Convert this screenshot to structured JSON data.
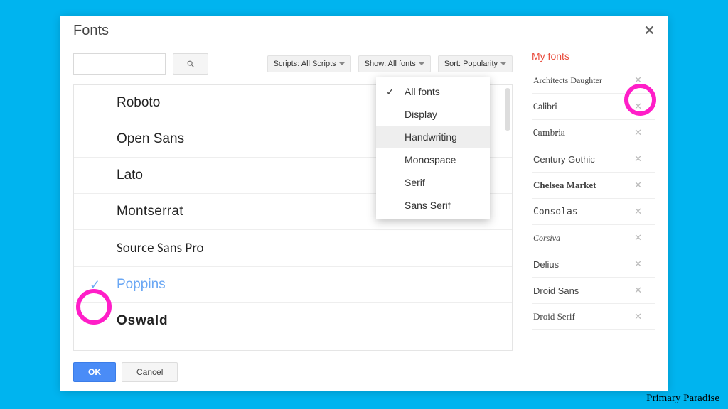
{
  "dialog": {
    "title": "Fonts",
    "search_placeholder": "",
    "filters": {
      "scripts": "Scripts: All Scripts",
      "show": "Show: All fonts",
      "sort": "Sort: Popularity"
    },
    "show_dropdown": {
      "options": [
        "All fonts",
        "Display",
        "Handwriting",
        "Monospace",
        "Serif",
        "Sans Serif"
      ],
      "selected": "All fonts",
      "hovered": "Handwriting"
    },
    "fonts": [
      {
        "name": "Roboto",
        "cls": "f-roboto",
        "selected": false
      },
      {
        "name": "Open Sans",
        "cls": "f-opensans",
        "selected": false
      },
      {
        "name": "Lato",
        "cls": "f-lato",
        "selected": false
      },
      {
        "name": "Montserrat",
        "cls": "f-mont",
        "selected": false
      },
      {
        "name": "Source Sans Pro",
        "cls": "f-source",
        "selected": false
      },
      {
        "name": "Poppins",
        "cls": "f-poppins",
        "selected": true
      },
      {
        "name": "Oswald",
        "cls": "f-oswald",
        "selected": false
      }
    ],
    "my_fonts_title": "My fonts",
    "my_fonts": [
      {
        "name": "Architects Daughter",
        "cls": "mf-arch"
      },
      {
        "name": "Calibri",
        "cls": "mf-cal"
      },
      {
        "name": "Cambria",
        "cls": "mf-cam"
      },
      {
        "name": "Century Gothic",
        "cls": "mf-cg"
      },
      {
        "name": "Chelsea Market",
        "cls": "mf-chel"
      },
      {
        "name": "Consolas",
        "cls": "mf-cons"
      },
      {
        "name": "Corsiva",
        "cls": "mf-cors"
      },
      {
        "name": "Delius",
        "cls": "mf-del"
      },
      {
        "name": "Droid Sans",
        "cls": "mf-droid"
      },
      {
        "name": "Droid Serif",
        "cls": "mf-droidserif"
      }
    ],
    "ok_label": "OK",
    "cancel_label": "Cancel"
  },
  "watermark": "Primary Paradise"
}
